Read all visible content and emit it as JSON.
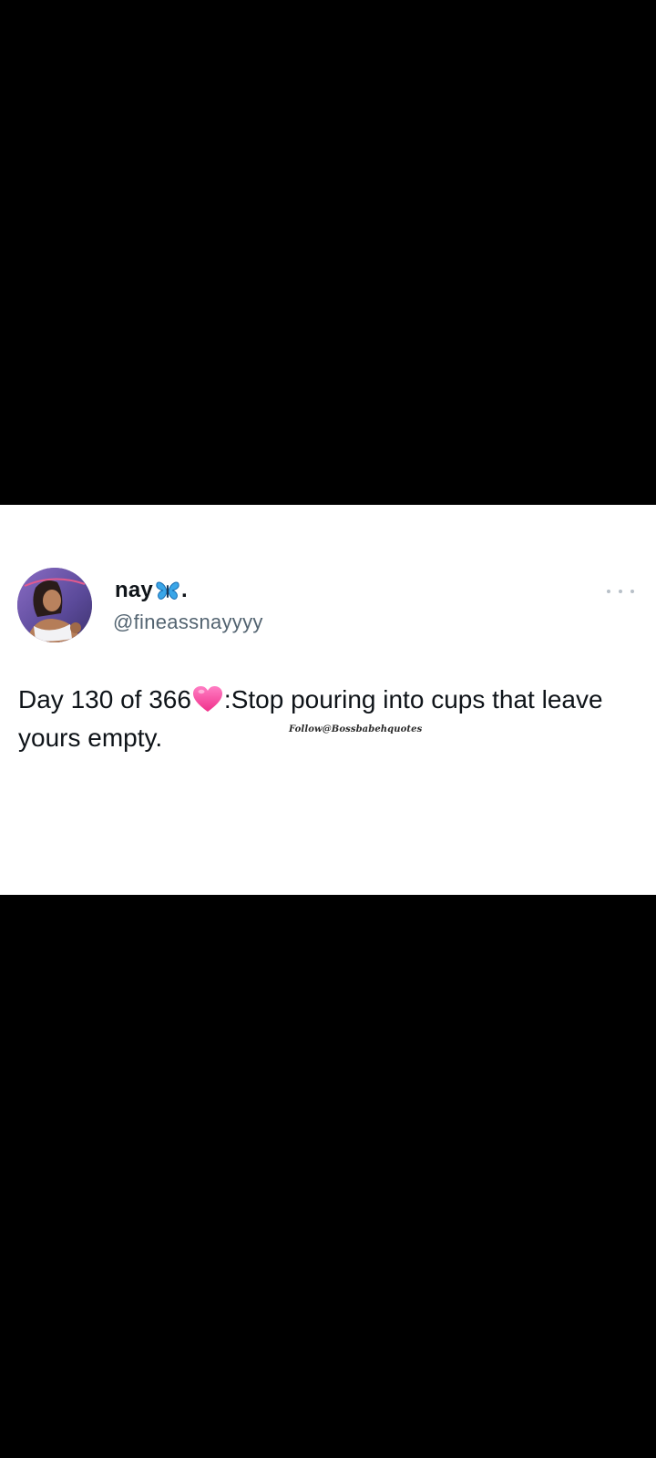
{
  "tweet": {
    "display_name": "nay",
    "name_suffix": ".",
    "name_icon": "blue-butterfly-icon",
    "handle": "@fineassnayyyy",
    "text_before_emoji": "Day 130 of 366",
    "emoji_icon": "pink-heart-icon",
    "text_after_emoji": ":Stop pouring into cups that leave yours empty.",
    "watermark": "Follow@Bossbabehquotes",
    "more_icon": "more-options-icon"
  },
  "colors": {
    "background": "#000000",
    "card": "#ffffff",
    "text_primary": "#0f1419",
    "text_secondary": "#536471",
    "butterfly": "#3aa6e8",
    "heart": "#ff4fa3"
  }
}
